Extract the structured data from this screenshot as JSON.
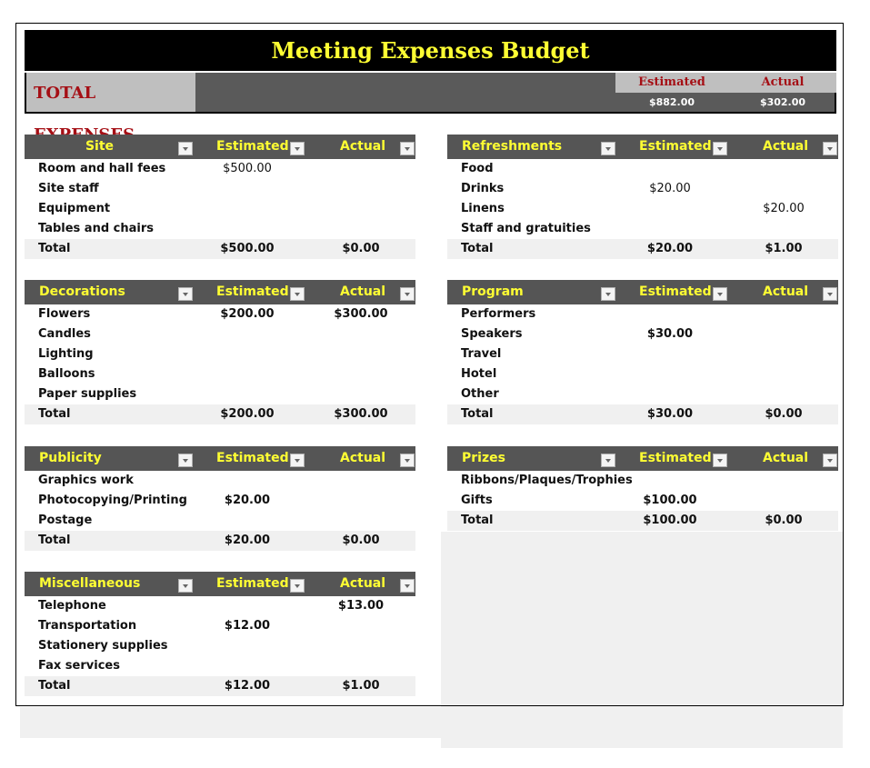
{
  "title": "Meeting Expenses Budget",
  "summary": {
    "label": "TOTAL EXPENSES",
    "estimated_label": "Estimated",
    "actual_label": "Actual",
    "estimated_value": "$882.00",
    "actual_value": "$302.00"
  },
  "colors": {
    "title_bg": "#000000",
    "title_text": "#ffff33",
    "header_bg": "#555555",
    "header_text": "#ffff33",
    "accent_red": "#a50f15"
  },
  "tables": [
    {
      "category": "Site",
      "estimated_header": "Estimated",
      "actual_header": "Actual",
      "rows": [
        {
          "item": "Room and hall fees",
          "estimated": "$500.00",
          "actual": ""
        },
        {
          "item": "Site staff",
          "estimated": "",
          "actual": ""
        },
        {
          "item": "Equipment",
          "estimated": "",
          "actual": ""
        },
        {
          "item": "Tables and chairs",
          "estimated": "",
          "actual": ""
        }
      ],
      "total": {
        "label": "Total",
        "estimated": "$500.00",
        "actual": "$0.00"
      }
    },
    {
      "category": "Refreshments",
      "estimated_header": "Estimated",
      "actual_header": "Actual",
      "rows": [
        {
          "item": "Food",
          "estimated": "",
          "actual": ""
        },
        {
          "item": "Drinks",
          "estimated": "$20.00",
          "actual": ""
        },
        {
          "item": "Linens",
          "estimated": "",
          "actual": "$20.00"
        },
        {
          "item": "Staff and gratuities",
          "estimated": "",
          "actual": ""
        }
      ],
      "total": {
        "label": "Total",
        "estimated": "$20.00",
        "actual": "$1.00"
      }
    },
    {
      "category": "Decorations",
      "estimated_header": "Estimated",
      "actual_header": "Actual",
      "rows": [
        {
          "item": "Flowers",
          "estimated": "$200.00",
          "actual": "$300.00"
        },
        {
          "item": "Candles",
          "estimated": "",
          "actual": ""
        },
        {
          "item": "Lighting",
          "estimated": "",
          "actual": ""
        },
        {
          "item": "Balloons",
          "estimated": "",
          "actual": ""
        },
        {
          "item": "Paper supplies",
          "estimated": "",
          "actual": ""
        }
      ],
      "total": {
        "label": "Total",
        "estimated": "$200.00",
        "actual": "$300.00"
      }
    },
    {
      "category": "Program",
      "estimated_header": "Estimated",
      "actual_header": "Actual",
      "rows": [
        {
          "item": "Performers",
          "estimated": "",
          "actual": ""
        },
        {
          "item": "Speakers",
          "estimated": "$30.00",
          "actual": ""
        },
        {
          "item": "Travel",
          "estimated": "",
          "actual": ""
        },
        {
          "item": "Hotel",
          "estimated": "",
          "actual": ""
        },
        {
          "item": "Other",
          "estimated": "",
          "actual": ""
        }
      ],
      "total": {
        "label": "Total",
        "estimated": "$30.00",
        "actual": "$0.00"
      }
    },
    {
      "category": "Publicity",
      "estimated_header": "Estimated",
      "actual_header": "Actual",
      "rows": [
        {
          "item": "Graphics work",
          "estimated": "",
          "actual": ""
        },
        {
          "item": "Photocopying/Printing",
          "estimated": "$20.00",
          "actual": ""
        },
        {
          "item": "Postage",
          "estimated": "",
          "actual": ""
        }
      ],
      "total": {
        "label": "Total",
        "estimated": "$20.00",
        "actual": "$0.00"
      }
    },
    {
      "category": "Prizes",
      "estimated_header": "Estimated",
      "actual_header": "Actual",
      "rows": [
        {
          "item": "Ribbons/Plaques/Trophies",
          "estimated": "",
          "actual": ""
        },
        {
          "item": "Gifts",
          "estimated": "$100.00",
          "actual": ""
        }
      ],
      "total": {
        "label": "Total",
        "estimated": "$100.00",
        "actual": "$0.00"
      }
    },
    {
      "category": "Miscellaneous",
      "estimated_header": "Estimated",
      "actual_header": "Actual",
      "rows": [
        {
          "item": "Telephone",
          "estimated": "",
          "actual": "$13.00"
        },
        {
          "item": "Transportation",
          "estimated": "$12.00",
          "actual": ""
        },
        {
          "item": "Stationery supplies",
          "estimated": "",
          "actual": ""
        },
        {
          "item": "Fax services",
          "estimated": "",
          "actual": ""
        }
      ],
      "total": {
        "label": "Total",
        "estimated": "$12.00",
        "actual": "$1.00"
      }
    }
  ]
}
